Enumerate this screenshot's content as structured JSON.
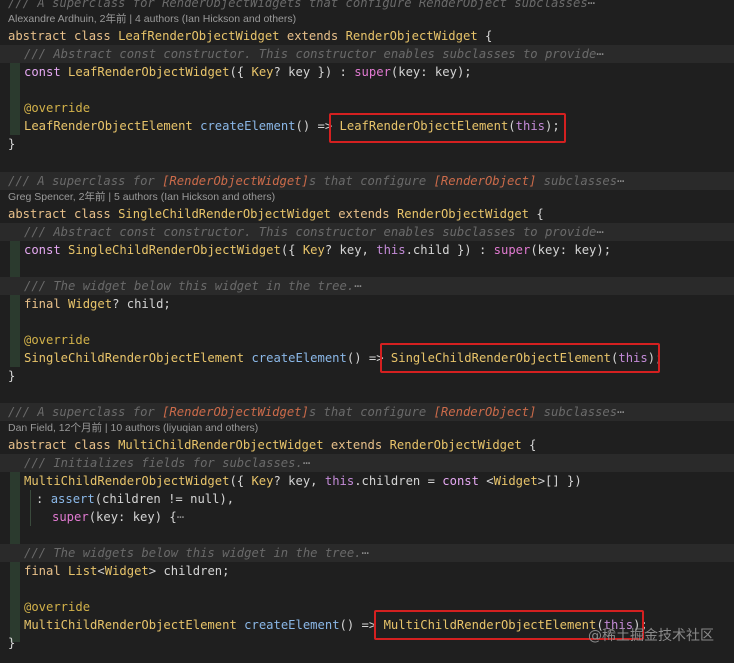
{
  "blocks": [
    {
      "doc": "/// A superclass for RenderObjectWidgets that configure RenderObject subclasses",
      "blame": "Alexandre Ardhuin, 2年前 | 4 authors (Ian Hickson and others)",
      "class_decl": {
        "abstract": "abstract",
        "class": "class",
        "name": "LeafRenderObjectWidget",
        "extends": "extends",
        "parent": "RenderObjectWidget",
        "brace": " {"
      },
      "ctor_doc": "/// Abstract const constructor. This constructor enables subclasses to provide",
      "ctor": {
        "const": "const",
        "name": "LeafRenderObjectWidget",
        "params": "({ ",
        "key_type": "Key",
        "key_rest": "? key }) : ",
        "super": "super",
        "super_args": "(key: key);"
      },
      "override": "@override",
      "create": {
        "ret": "LeafRenderObjectElement",
        "fn": "createElement",
        "parens": "() => ",
        "value": "LeafRenderObjectElement",
        "open": "(",
        "this": "this",
        "close": ");"
      },
      "close": "}"
    },
    {
      "doc_prefix": "/// A superclass for ",
      "doc_ref1": "[RenderObjectWidget]",
      "doc_mid": "s that configure ",
      "doc_ref2": "[RenderObject]",
      "doc_suffix": " subclasses",
      "blame": "Greg Spencer, 2年前 | 5 authors (Ian Hickson and others)",
      "class_decl": {
        "abstract": "abstract",
        "class": "class",
        "name": "SingleChildRenderObjectWidget",
        "extends": "extends",
        "parent": "RenderObjectWidget",
        "brace": " {"
      },
      "ctor_doc": "/// Abstract const constructor. This constructor enables subclasses to provide",
      "ctor": {
        "const": "const",
        "name": "SingleChildRenderObjectWidget",
        "params": "({ ",
        "key_type": "Key",
        "key_rest": "? key, ",
        "this": "this",
        "field": ".child }) : ",
        "super": "super",
        "super_args": "(key: key);"
      },
      "field_doc": "/// The widget below this widget in the tree.",
      "field": {
        "final": "final",
        "type": "Widget",
        "rest": "? child;"
      },
      "override": "@override",
      "create": {
        "ret": "SingleChildRenderObjectElement",
        "fn": "createElement",
        "parens": "() => ",
        "value": "SingleChildRenderObjectElement",
        "open": "(",
        "this": "this",
        "close": ");"
      },
      "close": "}"
    },
    {
      "doc_prefix": "/// A superclass for ",
      "doc_ref1": "[RenderObjectWidget]",
      "doc_mid": "s that configure ",
      "doc_ref2": "[RenderObject]",
      "doc_suffix": " subclasses",
      "blame": "Dan Field, 12个月前 | 10 authors (liyuqian and others)",
      "class_decl": {
        "abstract": "abstract",
        "class": "class",
        "name": "MultiChildRenderObjectWidget",
        "extends": "extends",
        "parent": "RenderObjectWidget",
        "brace": " {"
      },
      "ctor_doc": "/// Initializes fields for subclasses.",
      "ctor": {
        "name": "MultiChildRenderObjectWidget",
        "params": "({ ",
        "key_type": "Key",
        "key_rest": "? key, ",
        "this": "this",
        "field": ".children = ",
        "const": "const",
        "lt": " <",
        "widget": "Widget",
        "gt": ">[] })"
      },
      "assert_line": {
        "colon": ": ",
        "fn": "assert",
        "args": "(children != null),",
        "super": "super",
        "super_args": "(key: key) {"
      },
      "field_doc": "/// The widgets below this widget in the tree.",
      "field": {
        "final": "final",
        "type": "List",
        "lt": "<",
        "inner": "Widget",
        "rest": "> children;"
      },
      "override": "@override",
      "create": {
        "ret": "MultiChildRenderObjectElement",
        "fn": "createElement",
        "parens": "() => ",
        "value": "MultiChildRenderObjectElement",
        "open": "(",
        "this": "this",
        "close": ");"
      },
      "close": "}"
    }
  ],
  "fold_glyph": "⋯",
  "watermark": "@稀土掘金技术社区"
}
